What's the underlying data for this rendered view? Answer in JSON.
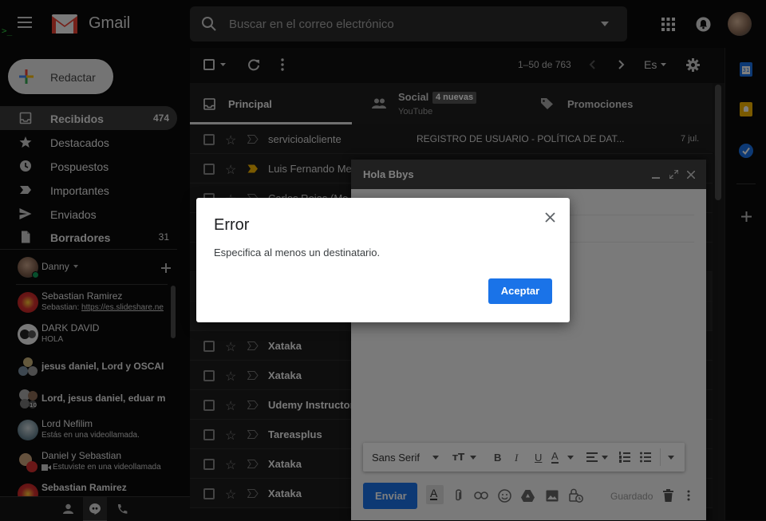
{
  "app": {
    "name": "Gmail"
  },
  "search": {
    "placeholder": "Buscar en el correo electrónico"
  },
  "compose_button": {
    "label": "Redactar"
  },
  "nav": [
    {
      "label": "Recibidos",
      "count": "474",
      "icon": "inbox-icon",
      "active": true,
      "bold": true
    },
    {
      "label": "Destacados",
      "count": "",
      "icon": "star-icon"
    },
    {
      "label": "Pospuestos",
      "count": "",
      "icon": "clock-icon"
    },
    {
      "label": "Importantes",
      "count": "",
      "icon": "important-icon"
    },
    {
      "label": "Enviados",
      "count": "",
      "icon": "send-icon"
    },
    {
      "label": "Borradores",
      "count": "31",
      "icon": "draft-icon",
      "bold": true
    }
  ],
  "hangouts": {
    "user": "Danny",
    "chats": [
      {
        "name": "Sebastian Ramirez",
        "sub": "Sebastian: ",
        "link": "https://es.slideshare.ne"
      },
      {
        "name": "DARK DAVID",
        "sub": "HOLA"
      },
      {
        "name": "jesus daniel, Lord y OSCAI",
        "sub": ""
      },
      {
        "name": "Lord, jesus daniel, eduar m",
        "sub": ""
      },
      {
        "name": "Lord Nefilim",
        "sub": "Estás en una videollamada."
      },
      {
        "name": "Daniel y Sebastian",
        "sub": "Estuviste en una videollamada"
      },
      {
        "name": "Sebastian Ramirez",
        "sub": ""
      }
    ]
  },
  "toolbar": {
    "pagination": "1–50 de 763",
    "lang": "Es"
  },
  "tabs": {
    "principal": "Principal",
    "social": "Social",
    "social_badge": "4 nuevas",
    "social_sub": "YouTube",
    "promociones": "Promociones"
  },
  "emails": [
    {
      "from": "servicioalcliente",
      "subject": "REGISTRO DE USUARIO - POLÍTICA DE DAT...",
      "date": "7 jul.",
      "bold": false,
      "important": false
    },
    {
      "from": "Luis Fernando Me",
      "subject": "",
      "date": "",
      "bold": false,
      "important": true
    },
    {
      "from": "Carlos Rojas (Me",
      "subject": "",
      "date": "",
      "bold": false,
      "important": false
    },
    {
      "from": "Xataka",
      "subject": "",
      "date": "",
      "bold": true,
      "important": false
    },
    {
      "from": "Xataka",
      "subject": "",
      "date": "",
      "bold": true,
      "important": false
    },
    {
      "from": "Udemy Instructor",
      "subject": "",
      "date": "",
      "bold": true,
      "important": false
    },
    {
      "from": "Tareasplus",
      "subject": "",
      "date": "",
      "bold": true,
      "important": false
    },
    {
      "from": "Xataka",
      "subject": "",
      "date": "",
      "bold": true,
      "important": false
    },
    {
      "from": "Xataka",
      "subject": "",
      "date": "",
      "bold": true,
      "important": false
    }
  ],
  "compose": {
    "title": "Hola Bbys",
    "font": "Sans Serif",
    "send_label": "Enviar",
    "saved_label": "Guardado"
  },
  "dialog": {
    "title": "Error",
    "message": "Especifica al menos un destinatario.",
    "ok_label": "Aceptar"
  },
  "colors": {
    "accent": "#1a73e8",
    "gmail_red": "#ea4335"
  }
}
